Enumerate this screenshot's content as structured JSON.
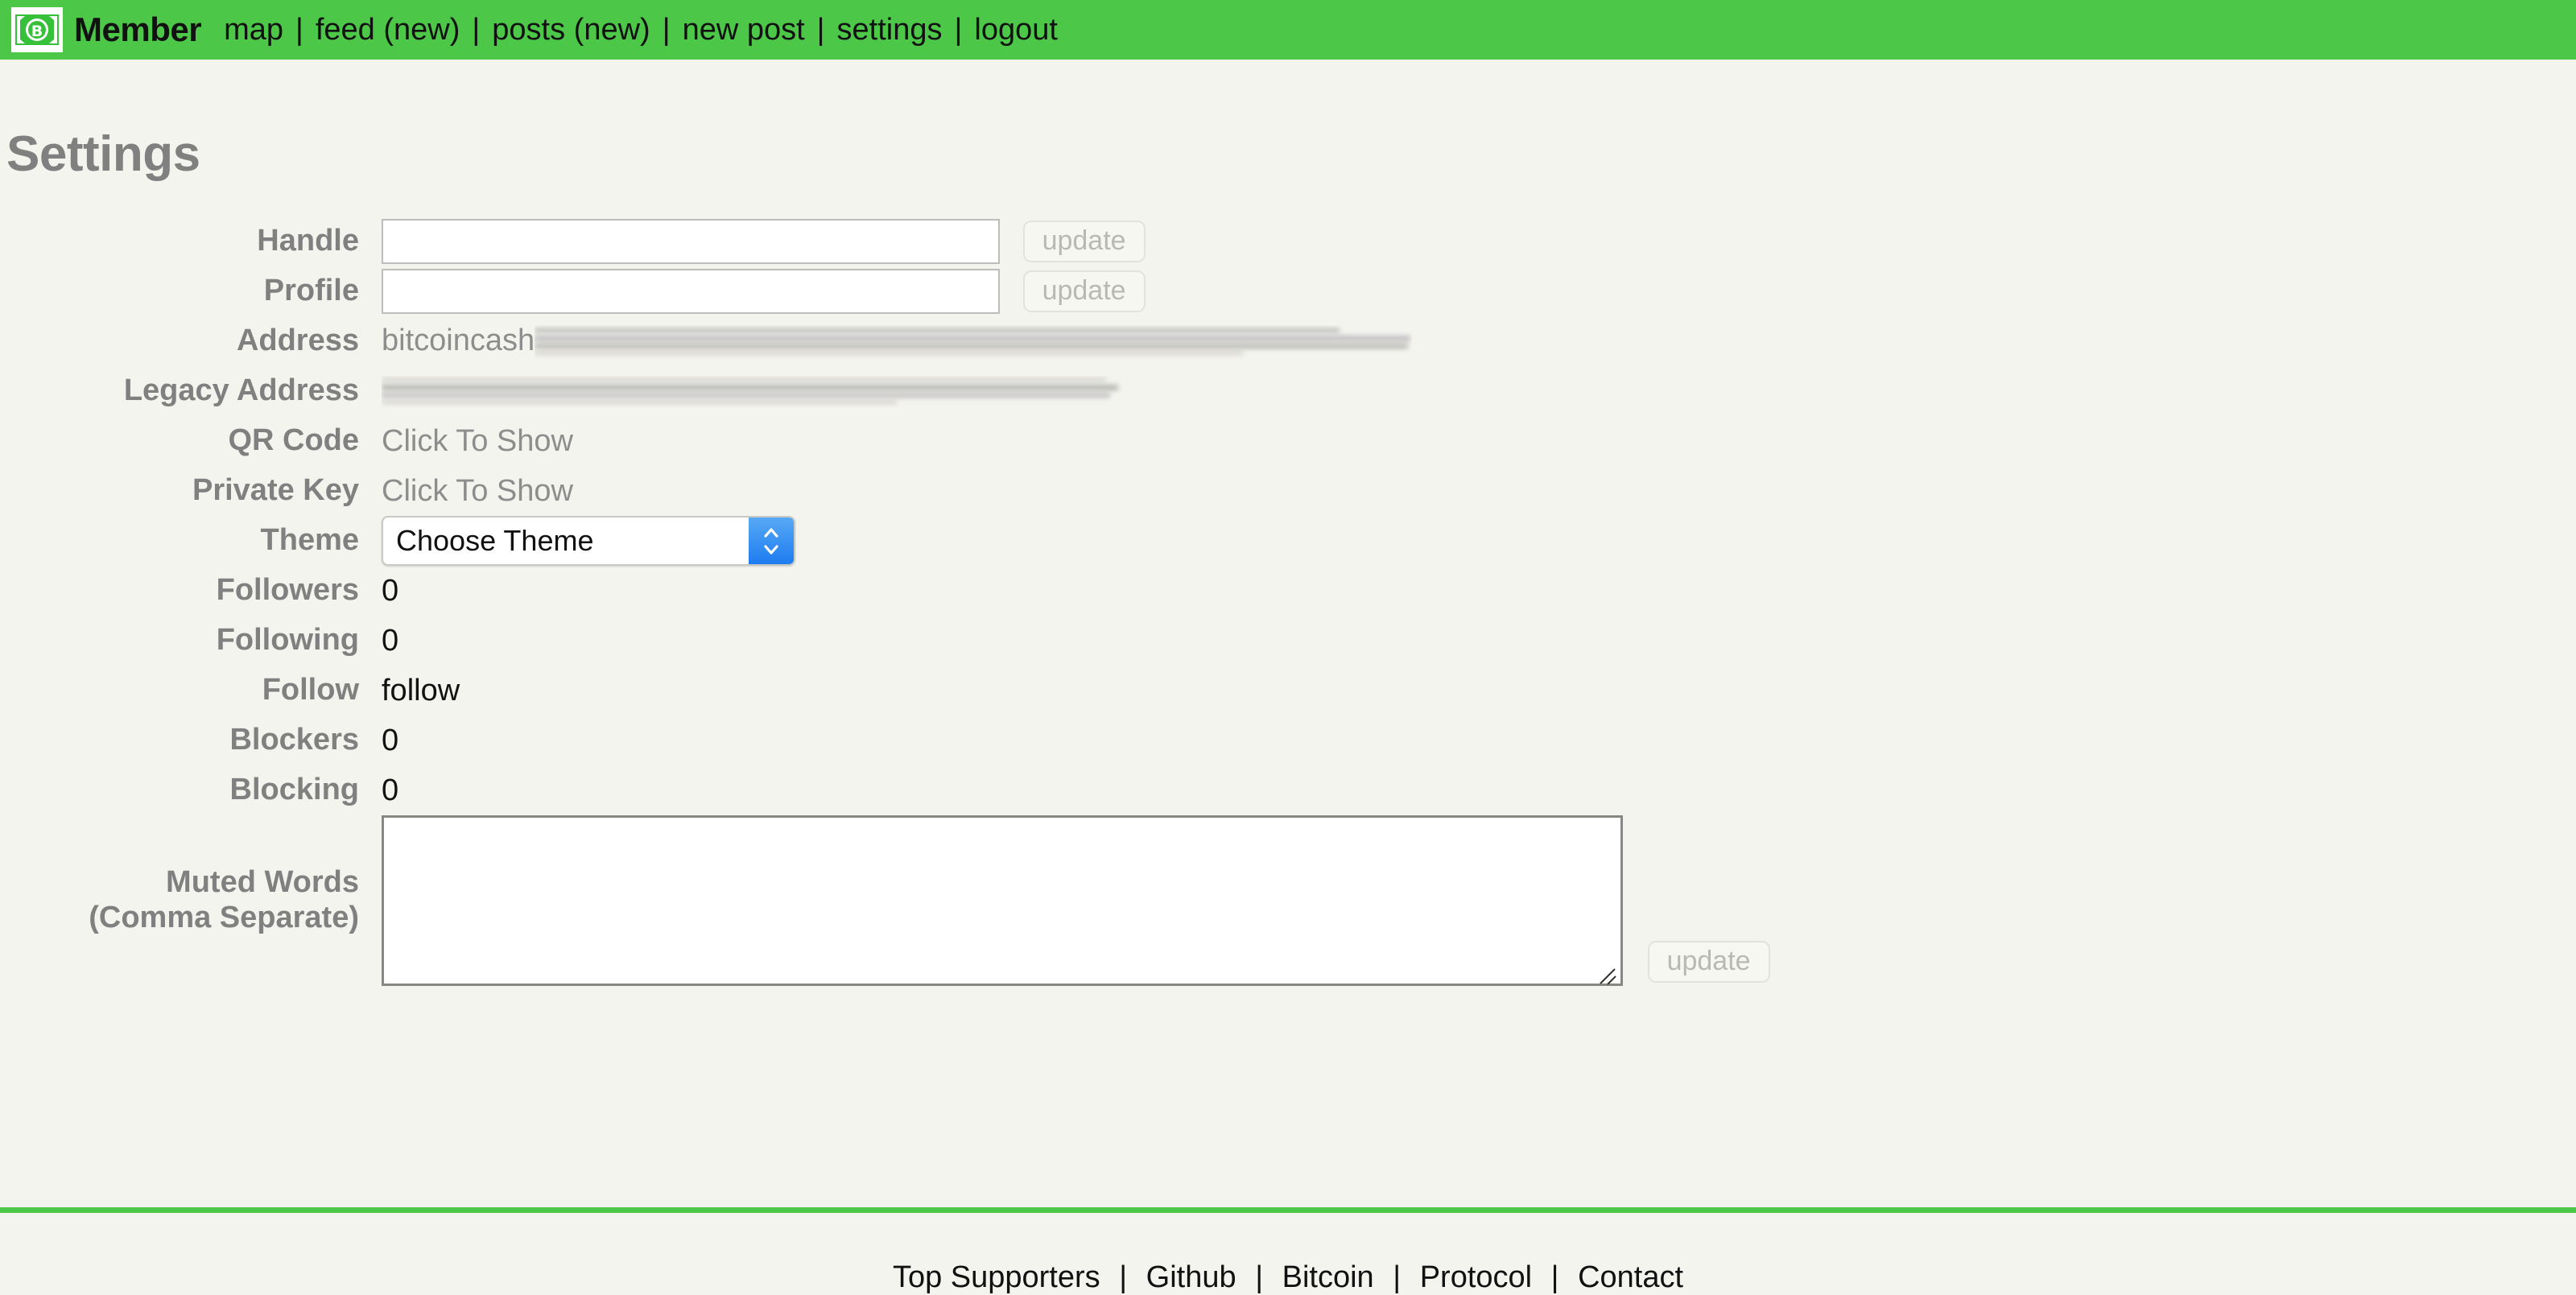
{
  "navbar": {
    "logo_icon": "banknote-bitcoin-icon",
    "brand": "Member",
    "separator": "|",
    "links": [
      {
        "label": "map",
        "name": "nav-link-map"
      },
      {
        "label": "feed (new)",
        "name": "nav-link-feed"
      },
      {
        "label": "posts (new)",
        "name": "nav-link-posts"
      },
      {
        "label": "new post",
        "name": "nav-link-new-post"
      },
      {
        "label": "settings",
        "name": "nav-link-settings"
      },
      {
        "label": "logout",
        "name": "nav-link-logout"
      }
    ]
  },
  "page": {
    "title": "Settings"
  },
  "form": {
    "handle": {
      "label": "Handle",
      "value": "",
      "placeholder": "",
      "button": "update"
    },
    "profile": {
      "label": "Profile",
      "value": "",
      "placeholder": "",
      "button": "update"
    },
    "address": {
      "label": "Address",
      "value_prefix": "bitcoincash",
      "redacted": true
    },
    "legacy_address": {
      "label": "Legacy Address",
      "value_prefix": "",
      "redacted": true
    },
    "qr_code": {
      "label": "QR Code",
      "value": "Click To Show"
    },
    "private_key": {
      "label": "Private Key",
      "value": "Click To Show"
    },
    "theme": {
      "label": "Theme",
      "selected": "Choose Theme",
      "stepper_icon": "chevron-up-down-icon"
    },
    "followers": {
      "label": "Followers",
      "value": "0"
    },
    "following": {
      "label": "Following",
      "value": "0"
    },
    "follow": {
      "label": "Follow",
      "value": "follow"
    },
    "blockers": {
      "label": "Blockers",
      "value": "0"
    },
    "blocking": {
      "label": "Blocking",
      "value": "0"
    },
    "muted_words": {
      "label_line1": "Muted Words",
      "label_line2": "(Comma Separate)",
      "value": "",
      "button": "update"
    }
  },
  "footer": {
    "separator": "|",
    "links": [
      {
        "label": "Top Supporters",
        "name": "footer-link-top-supporters"
      },
      {
        "label": "Github",
        "name": "footer-link-github"
      },
      {
        "label": "Bitcoin",
        "name": "footer-link-bitcoin"
      },
      {
        "label": "Protocol",
        "name": "footer-link-protocol"
      },
      {
        "label": "Contact",
        "name": "footer-link-contact"
      }
    ]
  },
  "colors": {
    "brand_green": "#4cc748",
    "page_background": "#f4f4ef",
    "label_gray": "#808080",
    "muted_gray": "#8d8d8d",
    "select_accent": "#1d7cf0"
  }
}
